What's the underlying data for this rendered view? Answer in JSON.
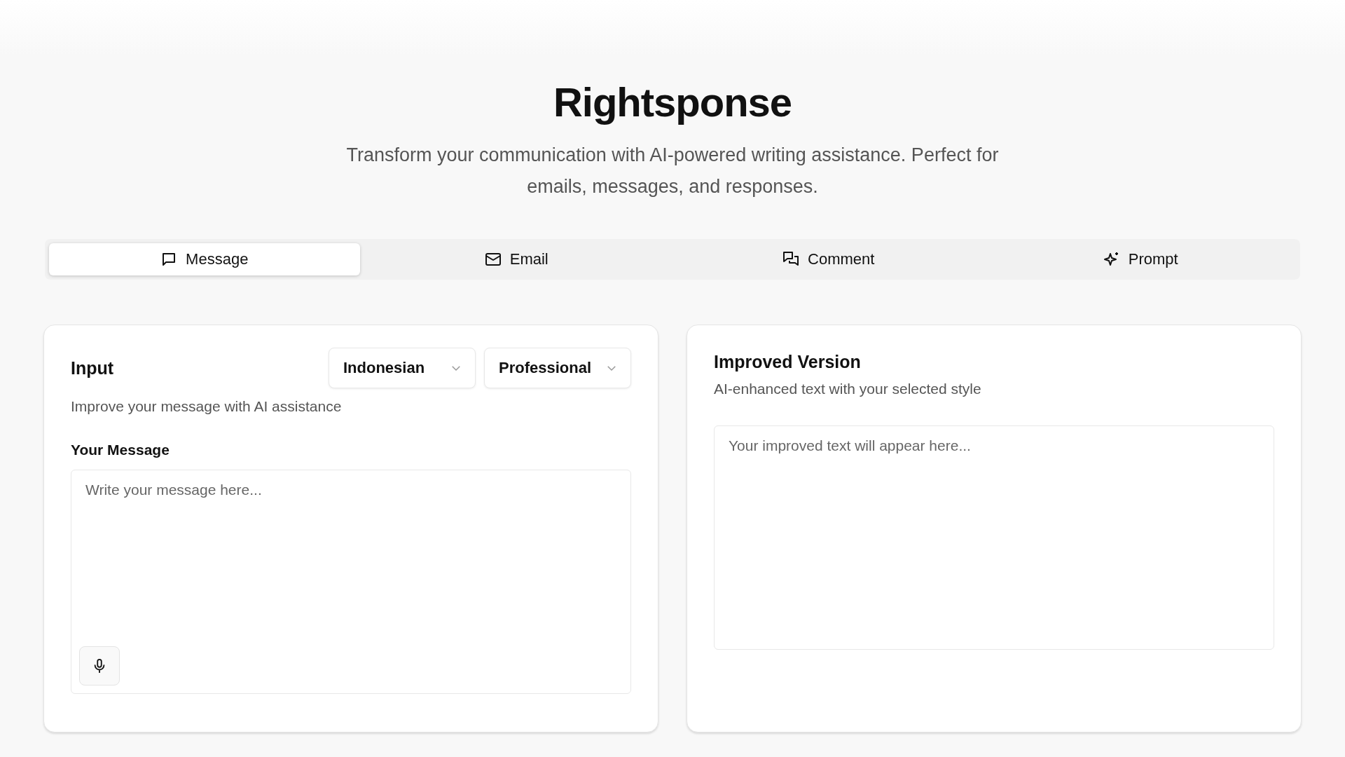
{
  "header": {
    "title": "Rightsponse",
    "subtitle": "Transform your communication with AI-powered writing assistance. Perfect for emails, messages, and responses."
  },
  "tabs": [
    {
      "label": "Message",
      "kind": "message",
      "selected": true
    },
    {
      "label": "Email",
      "kind": "email",
      "selected": false
    },
    {
      "label": "Comment",
      "kind": "comment",
      "selected": false
    },
    {
      "label": "Prompt",
      "kind": "prompt",
      "selected": false
    }
  ],
  "input_card": {
    "title": "Input",
    "dropdowns": [
      "Indonesian",
      "Professional"
    ],
    "description": "Improve your message with AI assistance",
    "field_label": "Your Message",
    "placeholder": "Write your message here..."
  },
  "output_card": {
    "title": "Improved Version",
    "description": "AI-enhanced text with your selected style",
    "placeholder": "Your improved text will appear here..."
  }
}
